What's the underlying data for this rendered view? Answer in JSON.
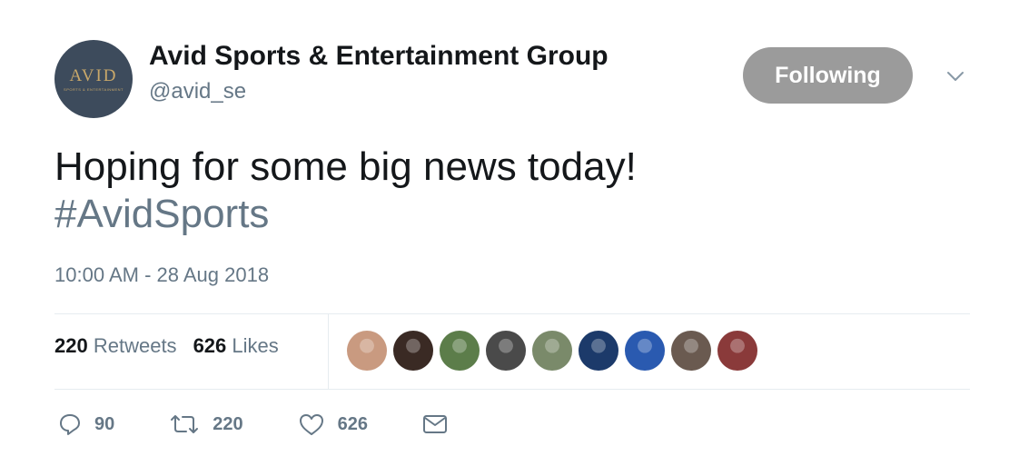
{
  "account": {
    "logo_word": "AVID",
    "logo_sub": "SPORTS & ENTERTAINMENT",
    "name": "Avid Sports & Entertainment Group",
    "handle": "@avid_se"
  },
  "follow_button": {
    "label": "Following"
  },
  "tweet": {
    "text": "Hoping for some big news today!",
    "hashtag": "#AvidSports",
    "timestamp": "10:00 AM - 28 Aug 2018"
  },
  "stats": {
    "retweets_count": "220",
    "retweets_label": "Retweets",
    "likes_count": "626",
    "likes_label": "Likes"
  },
  "likers": [
    {
      "color": "#c99a80"
    },
    {
      "color": "#3a2a24"
    },
    {
      "color": "#5c7d4a"
    },
    {
      "color": "#4a4a4a"
    },
    {
      "color": "#7a8a6a"
    },
    {
      "color": "#1c3a6a"
    },
    {
      "color": "#2a5ab0"
    },
    {
      "color": "#6a5a50"
    },
    {
      "color": "#8a3a3a"
    }
  ],
  "actions": {
    "reply_count": "90",
    "retweet_count": "220",
    "like_count": "626"
  },
  "icons": {
    "reply": "reply-icon",
    "retweet": "retweet-icon",
    "like": "heart-icon",
    "dm": "envelope-icon",
    "menu": "chevron-down-icon"
  }
}
